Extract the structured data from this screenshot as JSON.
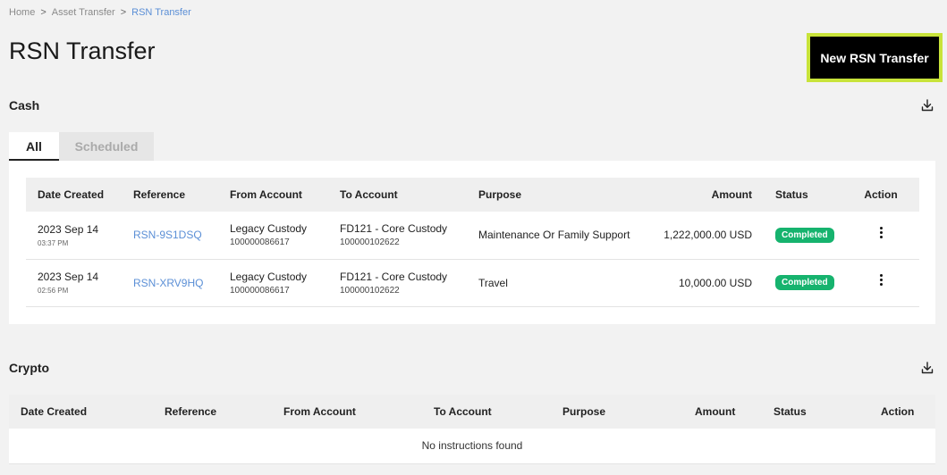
{
  "breadcrumb": {
    "home": "Home",
    "sep": ">",
    "asset": "Asset Transfer",
    "current": "RSN Transfer"
  },
  "page": {
    "title": "RSN Transfer",
    "new_button": "New RSN Transfer"
  },
  "cash": {
    "title": "Cash",
    "download_icon": "download-icon",
    "tabs": [
      {
        "label": "All",
        "active": true
      },
      {
        "label": "Scheduled",
        "active": false
      }
    ],
    "columns": [
      "Date Created",
      "Reference",
      "From Account",
      "To Account",
      "Purpose",
      "Amount",
      "Status",
      "Action"
    ],
    "rows": [
      {
        "date": "2023 Sep 14",
        "time": "03:37 PM",
        "reference": "RSN-9S1DSQ",
        "from_name": "Legacy Custody",
        "from_num": "100000086617",
        "to_name": "FD121 - Core Custody",
        "to_num": "100000102622",
        "purpose": "Maintenance Or Family Support",
        "amount": "1,222,000.00 USD",
        "status": "Completed"
      },
      {
        "date": "2023 Sep 14",
        "time": "02:56 PM",
        "reference": "RSN-XRV9HQ",
        "from_name": "Legacy Custody",
        "from_num": "100000086617",
        "to_name": "FD121 - Core Custody",
        "to_num": "100000102622",
        "purpose": "Travel",
        "amount": "10,000.00 USD",
        "status": "Completed"
      }
    ]
  },
  "crypto": {
    "title": "Crypto",
    "download_icon": "download-icon",
    "columns": [
      "Date Created",
      "Reference",
      "From Account",
      "To Account",
      "Purpose",
      "Amount",
      "Status",
      "Action"
    ],
    "empty_text": "No instructions found"
  },
  "colors": {
    "accent_outline": "#c8e33a",
    "link": "#5b8fd6",
    "status_completed": "#16b36e"
  }
}
